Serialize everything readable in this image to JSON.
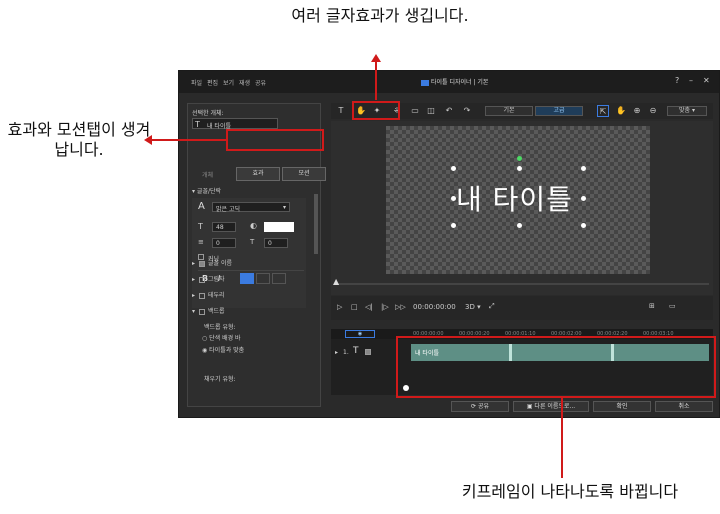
{
  "annotations": {
    "top": "여러 글자효과가 생깁니다.",
    "left": "효과와 모션탭이 생겨납니다.",
    "bottom": "키프레임이 나타나도록 바뀝니다"
  },
  "window": {
    "title": "타이틀 디자이너 | 기본",
    "help": "?",
    "minimize": "–",
    "maximize": "□",
    "close": "✕"
  },
  "menu": [
    "파일",
    "편집",
    "보기",
    "재생",
    "공유"
  ],
  "left_panel": {
    "selected_label": "선택한 개체:",
    "selected_value": "내 타이틀",
    "tab_object": "개체",
    "tab_effect": "효과",
    "tab_motion": "모션",
    "section_font": "글꼴/단락",
    "font_name": "맑은 고딕",
    "font_size": "48",
    "spacing1": "0",
    "spacing2": "0",
    "kerning": "커닝",
    "bold": "B",
    "italic": "I",
    "fill": "글꼴 이름",
    "shadow": "그림자",
    "border": "테두리",
    "background": "백드롭",
    "bg_type_label": "백드롭 유형:",
    "bg_opt1": "단색 배경 바",
    "bg_opt2": "타이틀과 맞춤",
    "fill_type_label": "채우기 유형:"
  },
  "toolbar": {
    "mode_basic": "기본",
    "mode_advanced": "고급",
    "zoom": "맞춤"
  },
  "preview": {
    "title_text": "내 타이틀"
  },
  "playback": {
    "timecode": "00:00:00:00",
    "mode3d": "3D"
  },
  "timeline": {
    "ruler": [
      "00:00:00:00",
      "00:00:00:20",
      "00:00:01:10",
      "00:00:02:00",
      "00:00:02:20",
      "00:00:03:10"
    ],
    "track_number": "1.",
    "clip_label": "내 타이틀",
    "keyframe_positions": [
      0.33,
      0.67
    ]
  },
  "bottom_buttons": {
    "share": "공유",
    "save_as": "다른 이름으로...",
    "ok": "확인",
    "cancel": "취소"
  },
  "colors": {
    "highlight_red": "#d01a1a",
    "clip_teal": "#5e8f85",
    "accent_blue": "#3b7be0"
  }
}
